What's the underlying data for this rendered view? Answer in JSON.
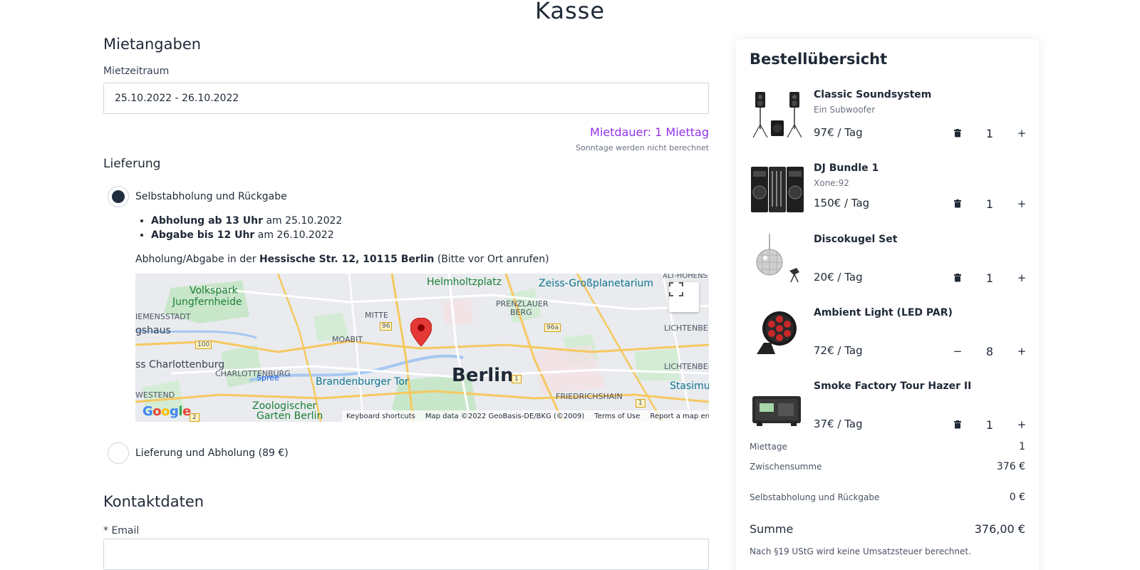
{
  "page": {
    "title": "Kasse"
  },
  "rental": {
    "heading": "Mietangaben",
    "period_label": "Mietzeitraum",
    "period_value": "25.10.2022 - 26.10.2022",
    "duration": "Mietdauer: 1 Miettag",
    "duration_note": "Sonntage werden nicht berechnet"
  },
  "delivery": {
    "heading": "Lieferung",
    "option_pickup": {
      "label": "Selbstabholung und Rückgabe",
      "pickup_bold": "Abholung ab 13 Uhr",
      "pickup_rest": " am 25.10.2022",
      "return_bold": "Abgabe bis 12 Uhr",
      "return_rest": " am 26.10.2022",
      "address_prefix": "Abholung/Abgabe in der ",
      "address_bold": "Hessische Str. 12, 10115 Berlin",
      "address_suffix": " (Bitte vor Ort anrufen)"
    },
    "option_delivery": {
      "label": "Lieferung und Abholung (89 €)"
    }
  },
  "map": {
    "labels": {
      "berlin": "Berlin",
      "helmholtzplatz": "Helmholtzplatz",
      "zeiss": "Zeiss-Großplanetarium",
      "volkspark": "Volkspark",
      "jungfernheide": "Jungfernheide",
      "siemensstadt": "IEMENSSTADT",
      "mitte": "MITTE",
      "prenzlauer": "PRENZLAUER",
      "berg": "BERG",
      "moabit": "MOABIT",
      "lichtenberg1": "LICHTENBE",
      "lichtenberg2": "LICHTENBER",
      "ghaus": "gshaus",
      "charlottenburg_castle": "ss Charlottenburg",
      "spree": "Spree",
      "brandenburger": "Brandenburger Tor",
      "westend": "WESTEND",
      "charlottenburg": "CHARLOTTENBURG",
      "friedrichshain": "FRIEDRICHSHAIN",
      "stasimu": "Stasimu",
      "zoo1": "Zoologischer",
      "zoo2": "Garten Berlin",
      "alt_hohens": "ALT-HOHENS",
      "road_100": "100",
      "road_96": "96",
      "road_96a": "96a",
      "road_1": "1",
      "road_1b": "1",
      "road_2": "2"
    },
    "google": "Google",
    "footer": {
      "shortcuts": "Keyboard shortcuts",
      "data": "Map data ©2022 GeoBasis-DE/BKG (©2009)",
      "terms": "Terms of Use",
      "report": "Report a map error"
    }
  },
  "contact": {
    "heading": "Kontaktdaten",
    "email_label": "* Email",
    "email_value": ""
  },
  "summary": {
    "title": "Bestellübersicht",
    "items": [
      {
        "name": "Classic Soundsystem",
        "sub": "Ein Subwoofer",
        "price": "97€ / Tag",
        "qty": "1",
        "minus_icon": "trash-icon"
      },
      {
        "name": "DJ Bundle 1",
        "sub": "Xone:92",
        "price": "150€ / Tag",
        "qty": "1",
        "minus_icon": "trash-icon"
      },
      {
        "name": "Discokugel Set",
        "sub": "",
        "price": "20€ / Tag",
        "qty": "1",
        "minus_icon": "trash-icon"
      },
      {
        "name": "Ambient Light (LED PAR)",
        "sub": "",
        "price": "72€ / Tag",
        "qty": "8",
        "minus_icon": "minus-icon"
      },
      {
        "name": "Smoke Factory Tour Hazer II",
        "sub": "",
        "price": "37€ / Tag",
        "qty": "1",
        "minus_icon": "trash-icon"
      }
    ],
    "rental_days_label": "Miettage",
    "rental_days_value": "1",
    "subtotal_label": "Zwischensumme",
    "subtotal_value": "376 €",
    "shipping_label": "Selbstabholung und Rückgabe",
    "shipping_value": "0 €",
    "sum_label": "Summe",
    "sum_value": "376,00 €",
    "tax_note": "Nach §19 UStG wird keine Umsatzsteuer berechnet."
  },
  "colors": {
    "accent": "#9333ea",
    "text": "#1f2937",
    "radio_fill": "#1f2d3d",
    "marker": "#e53935"
  }
}
